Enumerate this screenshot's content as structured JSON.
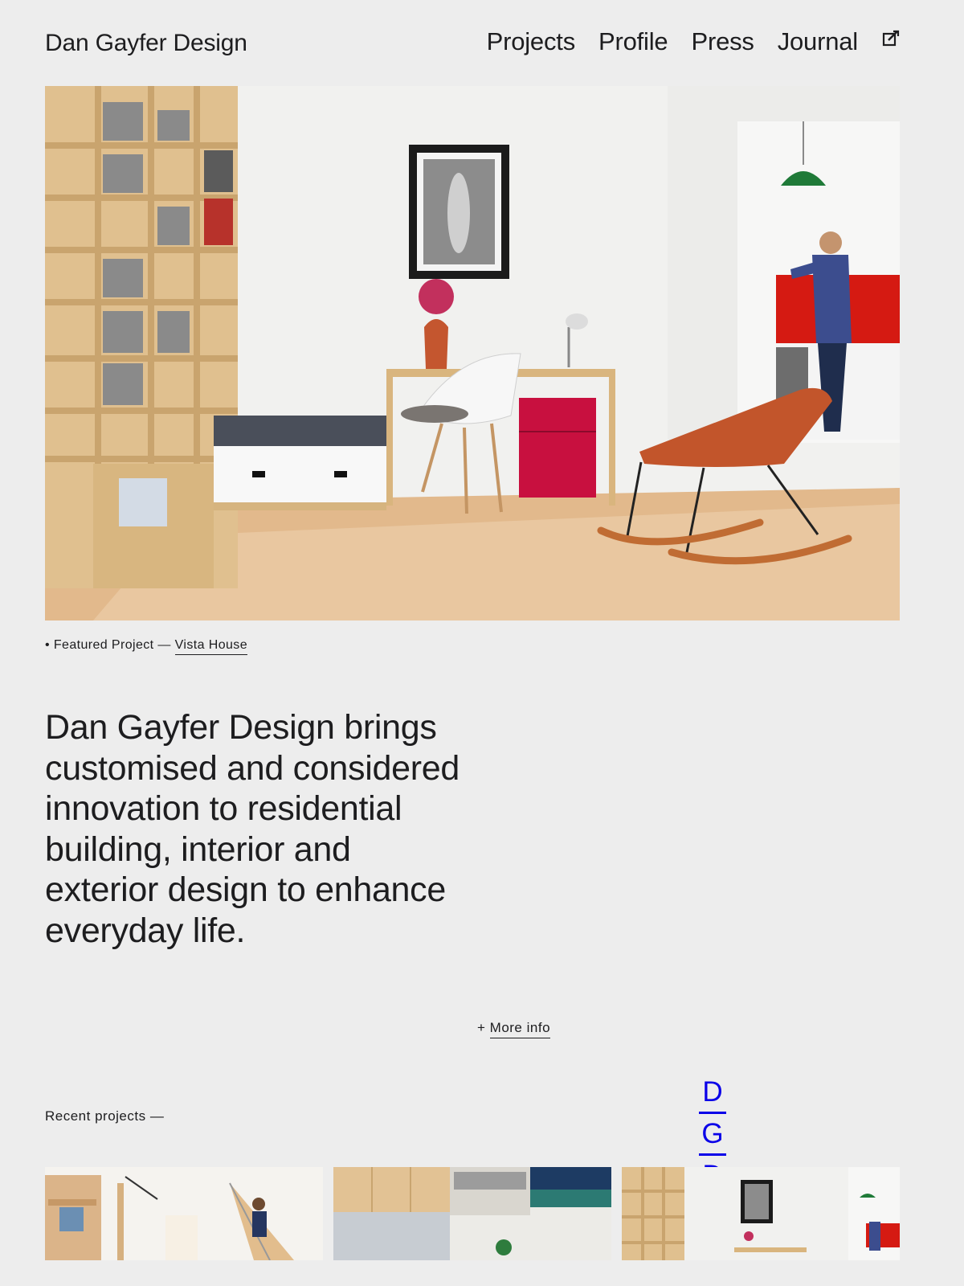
{
  "header": {
    "brand": "Dan Gayfer Design",
    "nav": [
      "Projects",
      "Profile",
      "Press",
      "Journal"
    ],
    "edit_icon": "external-link-icon"
  },
  "featured": {
    "prefix": "• Featured Project — ",
    "project_name": "Vista House"
  },
  "intro": "Dan Gayfer Design brings customised and considered innovation to residential building, interior and exterior design to enhance everyday life.",
  "more_info": {
    "prefix": "+ ",
    "label": "More info"
  },
  "recent_projects_label": "Recent projects —",
  "monogram": [
    "D",
    "G",
    "D"
  ],
  "colors": {
    "background": "#ededed",
    "text": "#1d1d1f",
    "accent": "#0a00e8"
  }
}
